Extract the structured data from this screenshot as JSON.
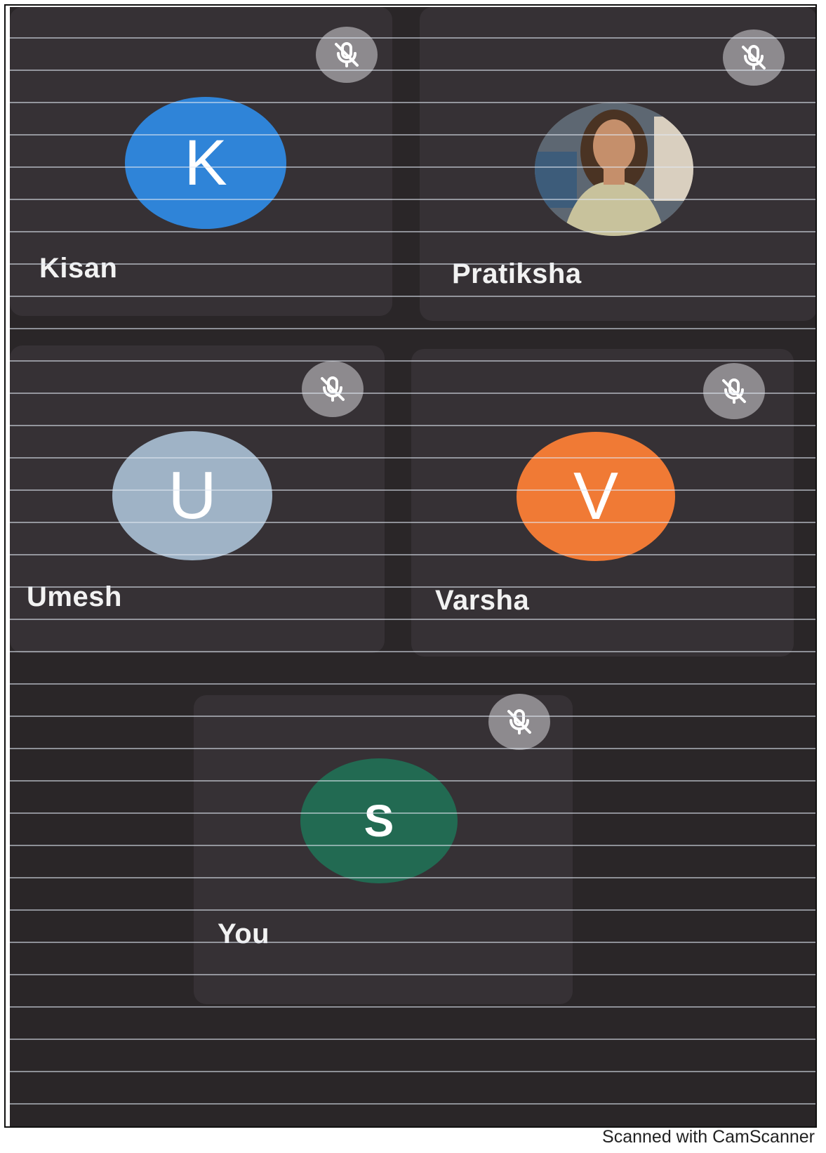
{
  "participants": [
    {
      "name": "Kisan",
      "initial": "K",
      "avatar_color": "#2f84d8",
      "muted": true
    },
    {
      "name": "Pratiksha",
      "initial": "",
      "avatar_color": "#6a5a48",
      "muted": true,
      "has_photo": true
    },
    {
      "name": "Umesh",
      "initial": "U",
      "avatar_color": "#9fb3c6",
      "muted": true
    },
    {
      "name": "Varsha",
      "initial": "V",
      "avatar_color": "#f07a35",
      "muted": true
    },
    {
      "name": "You",
      "initial": "S",
      "avatar_color": "#226a52",
      "muted": true
    }
  ],
  "icons": {
    "mute": "mic-off-icon"
  },
  "footer": {
    "text": "Scanned with CamScanner"
  }
}
